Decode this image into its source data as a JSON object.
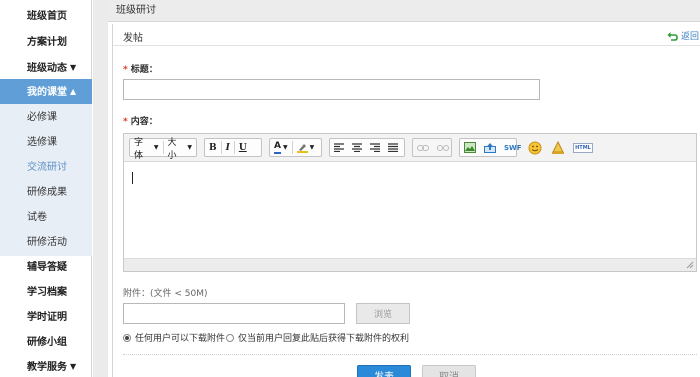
{
  "sidebar": {
    "items": [
      {
        "label": "班级首页",
        "caret": ""
      },
      {
        "label": "方案计划",
        "caret": ""
      },
      {
        "label": "班级动态",
        "caret": "▼"
      },
      {
        "label": "我的课堂",
        "caret": "▲"
      }
    ],
    "subitems": [
      {
        "label": "必修课"
      },
      {
        "label": "选修课"
      },
      {
        "label": "交流研讨"
      },
      {
        "label": "研修成果"
      },
      {
        "label": "试卷"
      },
      {
        "label": "研修活动"
      }
    ],
    "bottom_items": [
      {
        "label": "辅导答疑",
        "caret": ""
      },
      {
        "label": "学习档案",
        "caret": ""
      },
      {
        "label": "学时证明",
        "caret": ""
      },
      {
        "label": "研修小组",
        "caret": ""
      },
      {
        "label": "教学服务",
        "caret": "▼"
      }
    ]
  },
  "header": {
    "title": "班级研讨"
  },
  "panel": {
    "title": "发帖",
    "back_label": "返回"
  },
  "form": {
    "required_mark": "*",
    "title_label": "标题：",
    "title_value": "",
    "content_label": "内容：",
    "attachment_label": "附件：(文件 < 50M)",
    "browse_label": "浏览",
    "radio_all": "任何用户可以下载附件",
    "radio_reply": "仅当前用户回复此贴后获得下载附件的权利",
    "submit_label": "发表",
    "cancel_label": "取消"
  },
  "toolbar": {
    "font_label": "字体",
    "size_label": "大小",
    "bold": "B",
    "italic": "I",
    "underline": "U",
    "font_color": "A",
    "swf": "SWF",
    "html": "HTML"
  },
  "colors": {
    "active_nav": "#5f9ed6",
    "submit_button": "#2b8ad8",
    "link": "#3a7cc2",
    "required": "#d93a2b"
  }
}
